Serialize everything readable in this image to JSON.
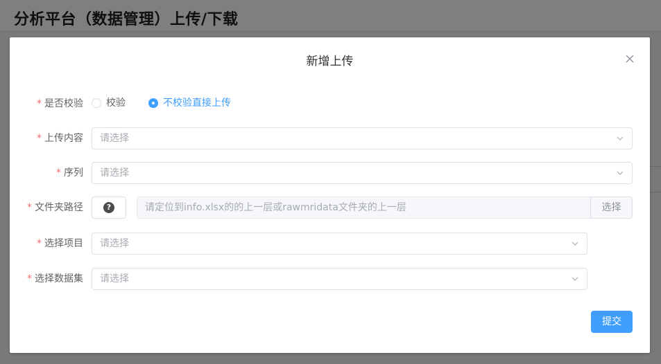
{
  "page": {
    "title": "分析平台（数据管理）上传/下载"
  },
  "dialog": {
    "title": "新增上传",
    "submit_label": "提交",
    "fields": {
      "verify": {
        "label": "是否校验",
        "required_mark": "*",
        "options": [
          "校验",
          "不校验直接上传"
        ],
        "selected": "不校验直接上传"
      },
      "upload_content": {
        "label": "上传内容",
        "required_mark": "*",
        "placeholder": "请选择"
      },
      "sequence": {
        "label": "序列",
        "required_mark": "*",
        "placeholder": "请选择"
      },
      "folder_path": {
        "label": "文件夹路径",
        "required_mark": "*",
        "help_icon": "?",
        "placeholder": "请定位到info.xlsx的的上一层或rawmridata文件夹的上一层",
        "button_label": "选择"
      },
      "project": {
        "label": "选择项目",
        "required_mark": "*",
        "placeholder": "请选择"
      },
      "dataset": {
        "label": "选择数据集",
        "required_mark": "*",
        "placeholder": "请选择"
      }
    }
  },
  "colors": {
    "primary": "#409eff",
    "required": "#f56c6c",
    "overlay": "rgba(0,0,0,0.5)"
  }
}
